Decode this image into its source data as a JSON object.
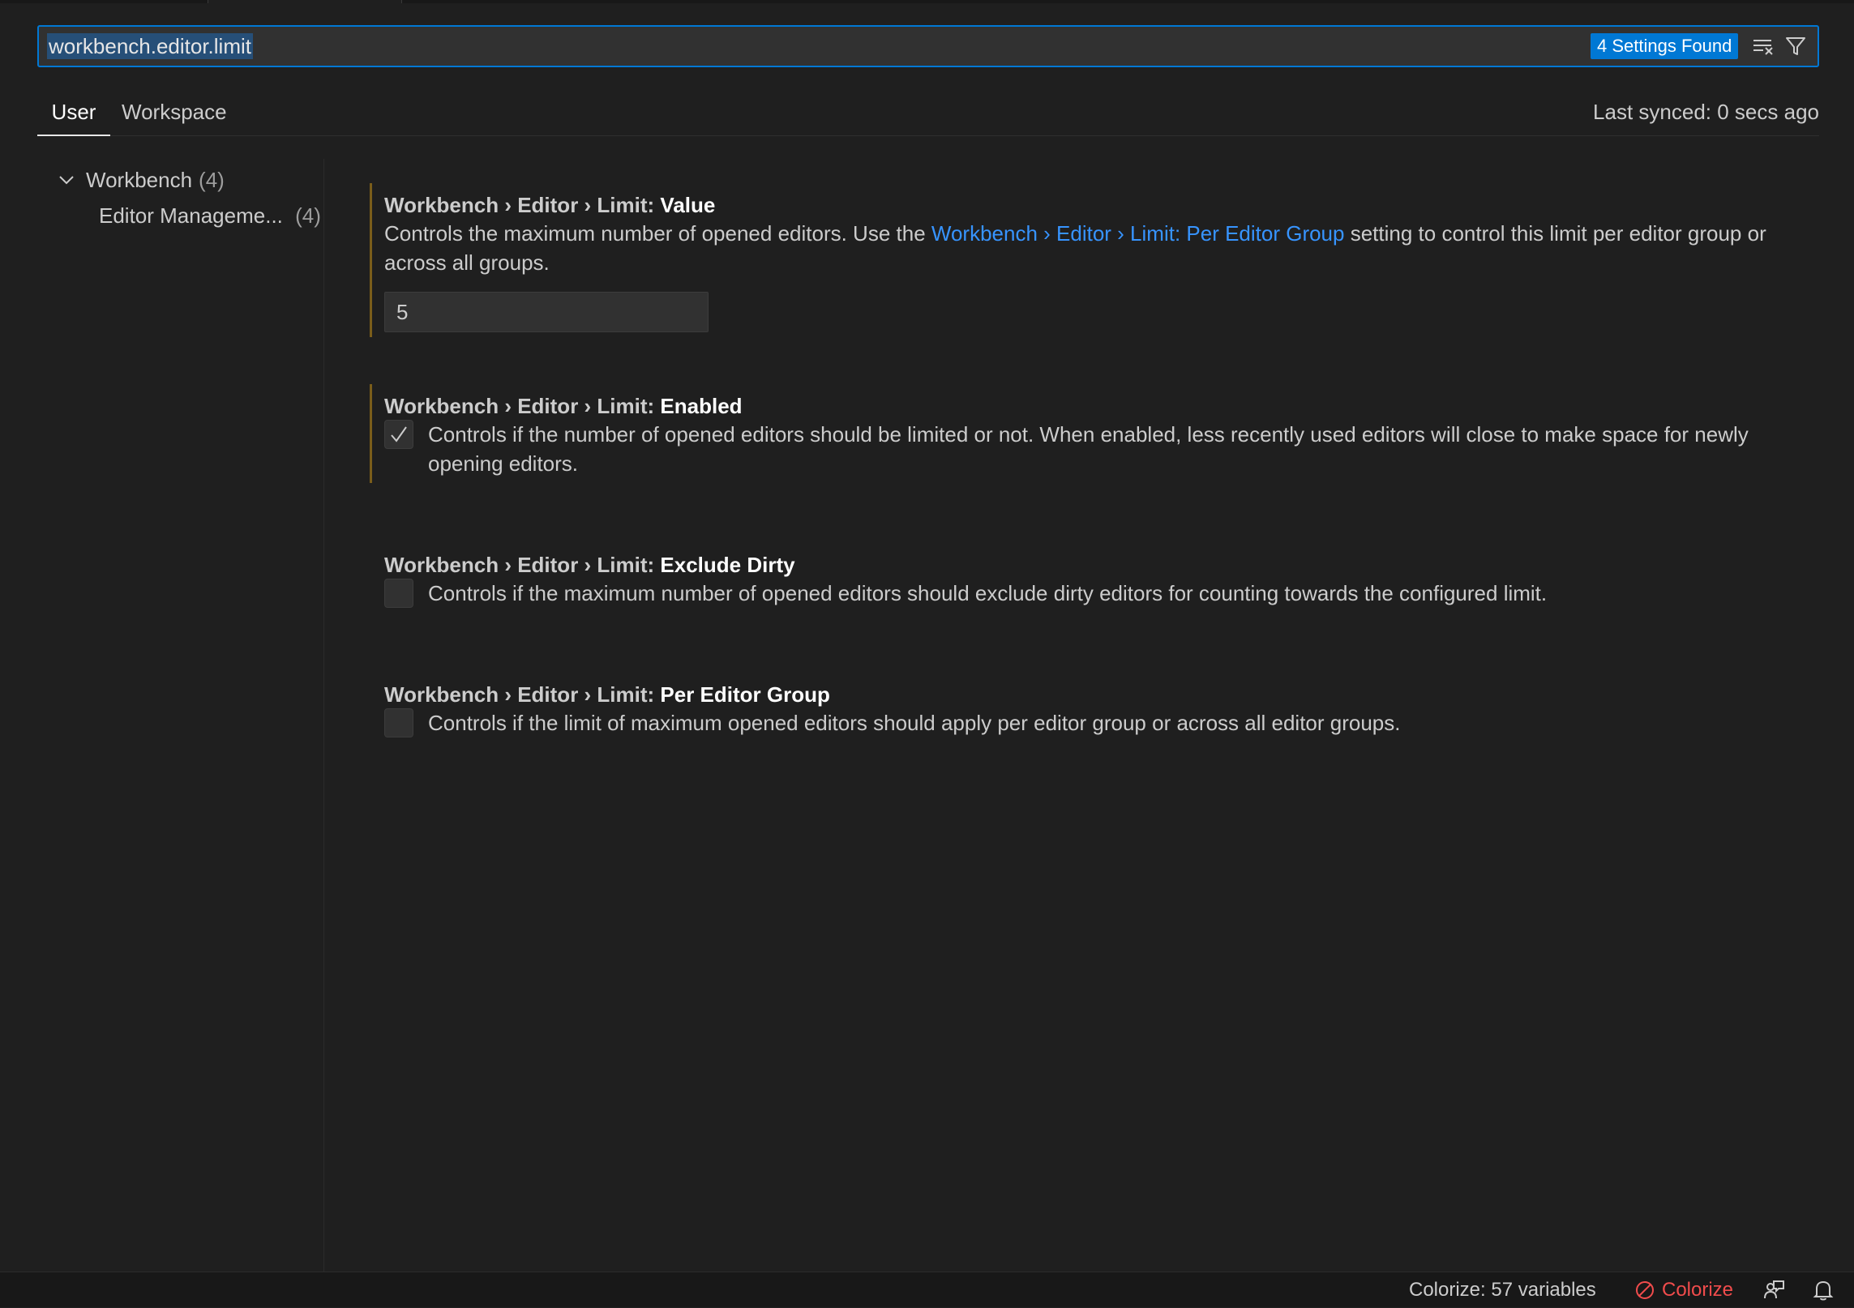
{
  "search": {
    "query": "workbench.editor.limit",
    "results_badge": "4 Settings Found",
    "icons": [
      "clear-filter-icon",
      "filter-icon"
    ]
  },
  "tabs": [
    {
      "label": "User",
      "active": true
    },
    {
      "label": "Workspace",
      "active": false
    }
  ],
  "last_synced": "Last synced: 0 secs ago",
  "toc": {
    "root_label": "Workbench",
    "root_count": "(4)",
    "child_label": "Editor Manageme...",
    "child_count": "(4)"
  },
  "settings": [
    {
      "prefix": "Workbench › Editor › Limit: ",
      "key": "Value",
      "description_before": "Controls the maximum number of opened editors. Use the ",
      "description_link": "Workbench › Editor › Limit: Per Editor Group",
      "description_after": " setting to control this limit per editor group or across all groups.",
      "value": "5",
      "modified": true
    },
    {
      "prefix": "Workbench › Editor › Limit: ",
      "key": "Enabled",
      "description": "Controls if the number of opened editors should be limited or not. When enabled, less recently used editors will close to make space for newly opening editors.",
      "checked": true,
      "modified": true
    },
    {
      "prefix": "Workbench › Editor › Limit: ",
      "key": "Exclude Dirty",
      "description": "Controls if the maximum number of opened editors should exclude dirty editors for counting towards the configured limit.",
      "checked": false,
      "modified": false
    },
    {
      "prefix": "Workbench › Editor › Limit: ",
      "key": "Per Editor Group",
      "description": "Controls if the limit of maximum opened editors should apply per editor group or across all editor groups.",
      "checked": false,
      "modified": false
    }
  ],
  "status_bar": {
    "colorize_count": "Colorize: 57 variables",
    "colorize_button": "Colorize",
    "icons": [
      "feedback-icon",
      "bell-icon"
    ]
  },
  "colors": {
    "accent": "#0078d4",
    "link": "#3794ff",
    "modified_indicator": "#7a5d1a",
    "error": "#f14c4c"
  }
}
